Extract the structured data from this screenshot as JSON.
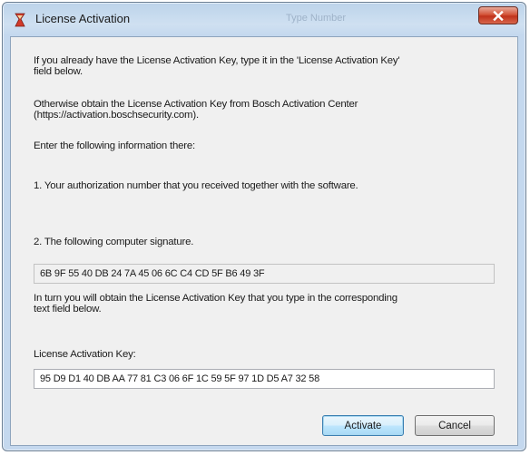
{
  "window": {
    "title": "License Activation",
    "ghost_title": "Type Number"
  },
  "content": {
    "intro_line1": "If you already have the License Activation Key, type it in the 'License Activation Key'",
    "intro_line2": "field below.",
    "obtain_line1": "Otherwise obtain the License Activation Key from Bosch Activation Center",
    "obtain_line2": "(https://activation.boschsecurity.com).",
    "enter_info": "Enter the following information there:",
    "step1": "1. Your authorization number that you received together with the software.",
    "step2": "2. The following computer signature.",
    "signature": "6B 9F 55 40 DB 24 7A 45 06 6C C4 CD 5F B6 49 3F",
    "in_turn_line1": "In turn you will obtain the License Activation Key that you type in the corresponding",
    "in_turn_line2": "text field below.",
    "key_label": "License Activation Key:",
    "key_value": "95 D9 D1 40 DB AA 77 81 C3 06 6F 1C 59 5F 97 1D D5 A7 32 58"
  },
  "buttons": {
    "activate": "Activate",
    "cancel": "Cancel"
  },
  "colors": {
    "close_button": "#c7391f",
    "default_button_border": "#3c7fb1"
  }
}
